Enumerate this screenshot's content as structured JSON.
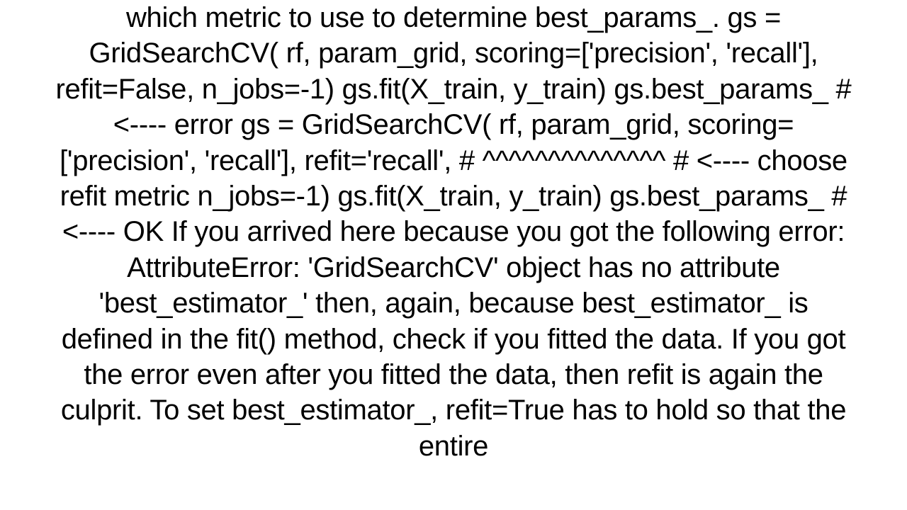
{
  "text": "which metric to use to determine best_params_. gs = GridSearchCV(     rf, param_grid,      scoring=['precision', 'recall'], refit=False,      n_jobs=-1) gs.fit(X_train, y_train) gs.best_params_                            # <---- error  gs = GridSearchCV(     rf, param_grid,      scoring=['precision', 'recall'], refit='recall', #                               ^^^^^^^^^^^^^^    # <---- choose refit metric     n_jobs=-1) gs.fit(X_train, y_train) gs.best_params_                            # <---- OK   If you arrived here because you got the following error: AttributeError: 'GridSearchCV' object has no attribute 'best_estimator_'  then, again, because best_estimator_ is defined in the fit() method, check if you fitted the data. If you got the error even after you fitted the data, then refit is again the culprit. To set best_estimator_, refit=True has to hold so that the entire"
}
